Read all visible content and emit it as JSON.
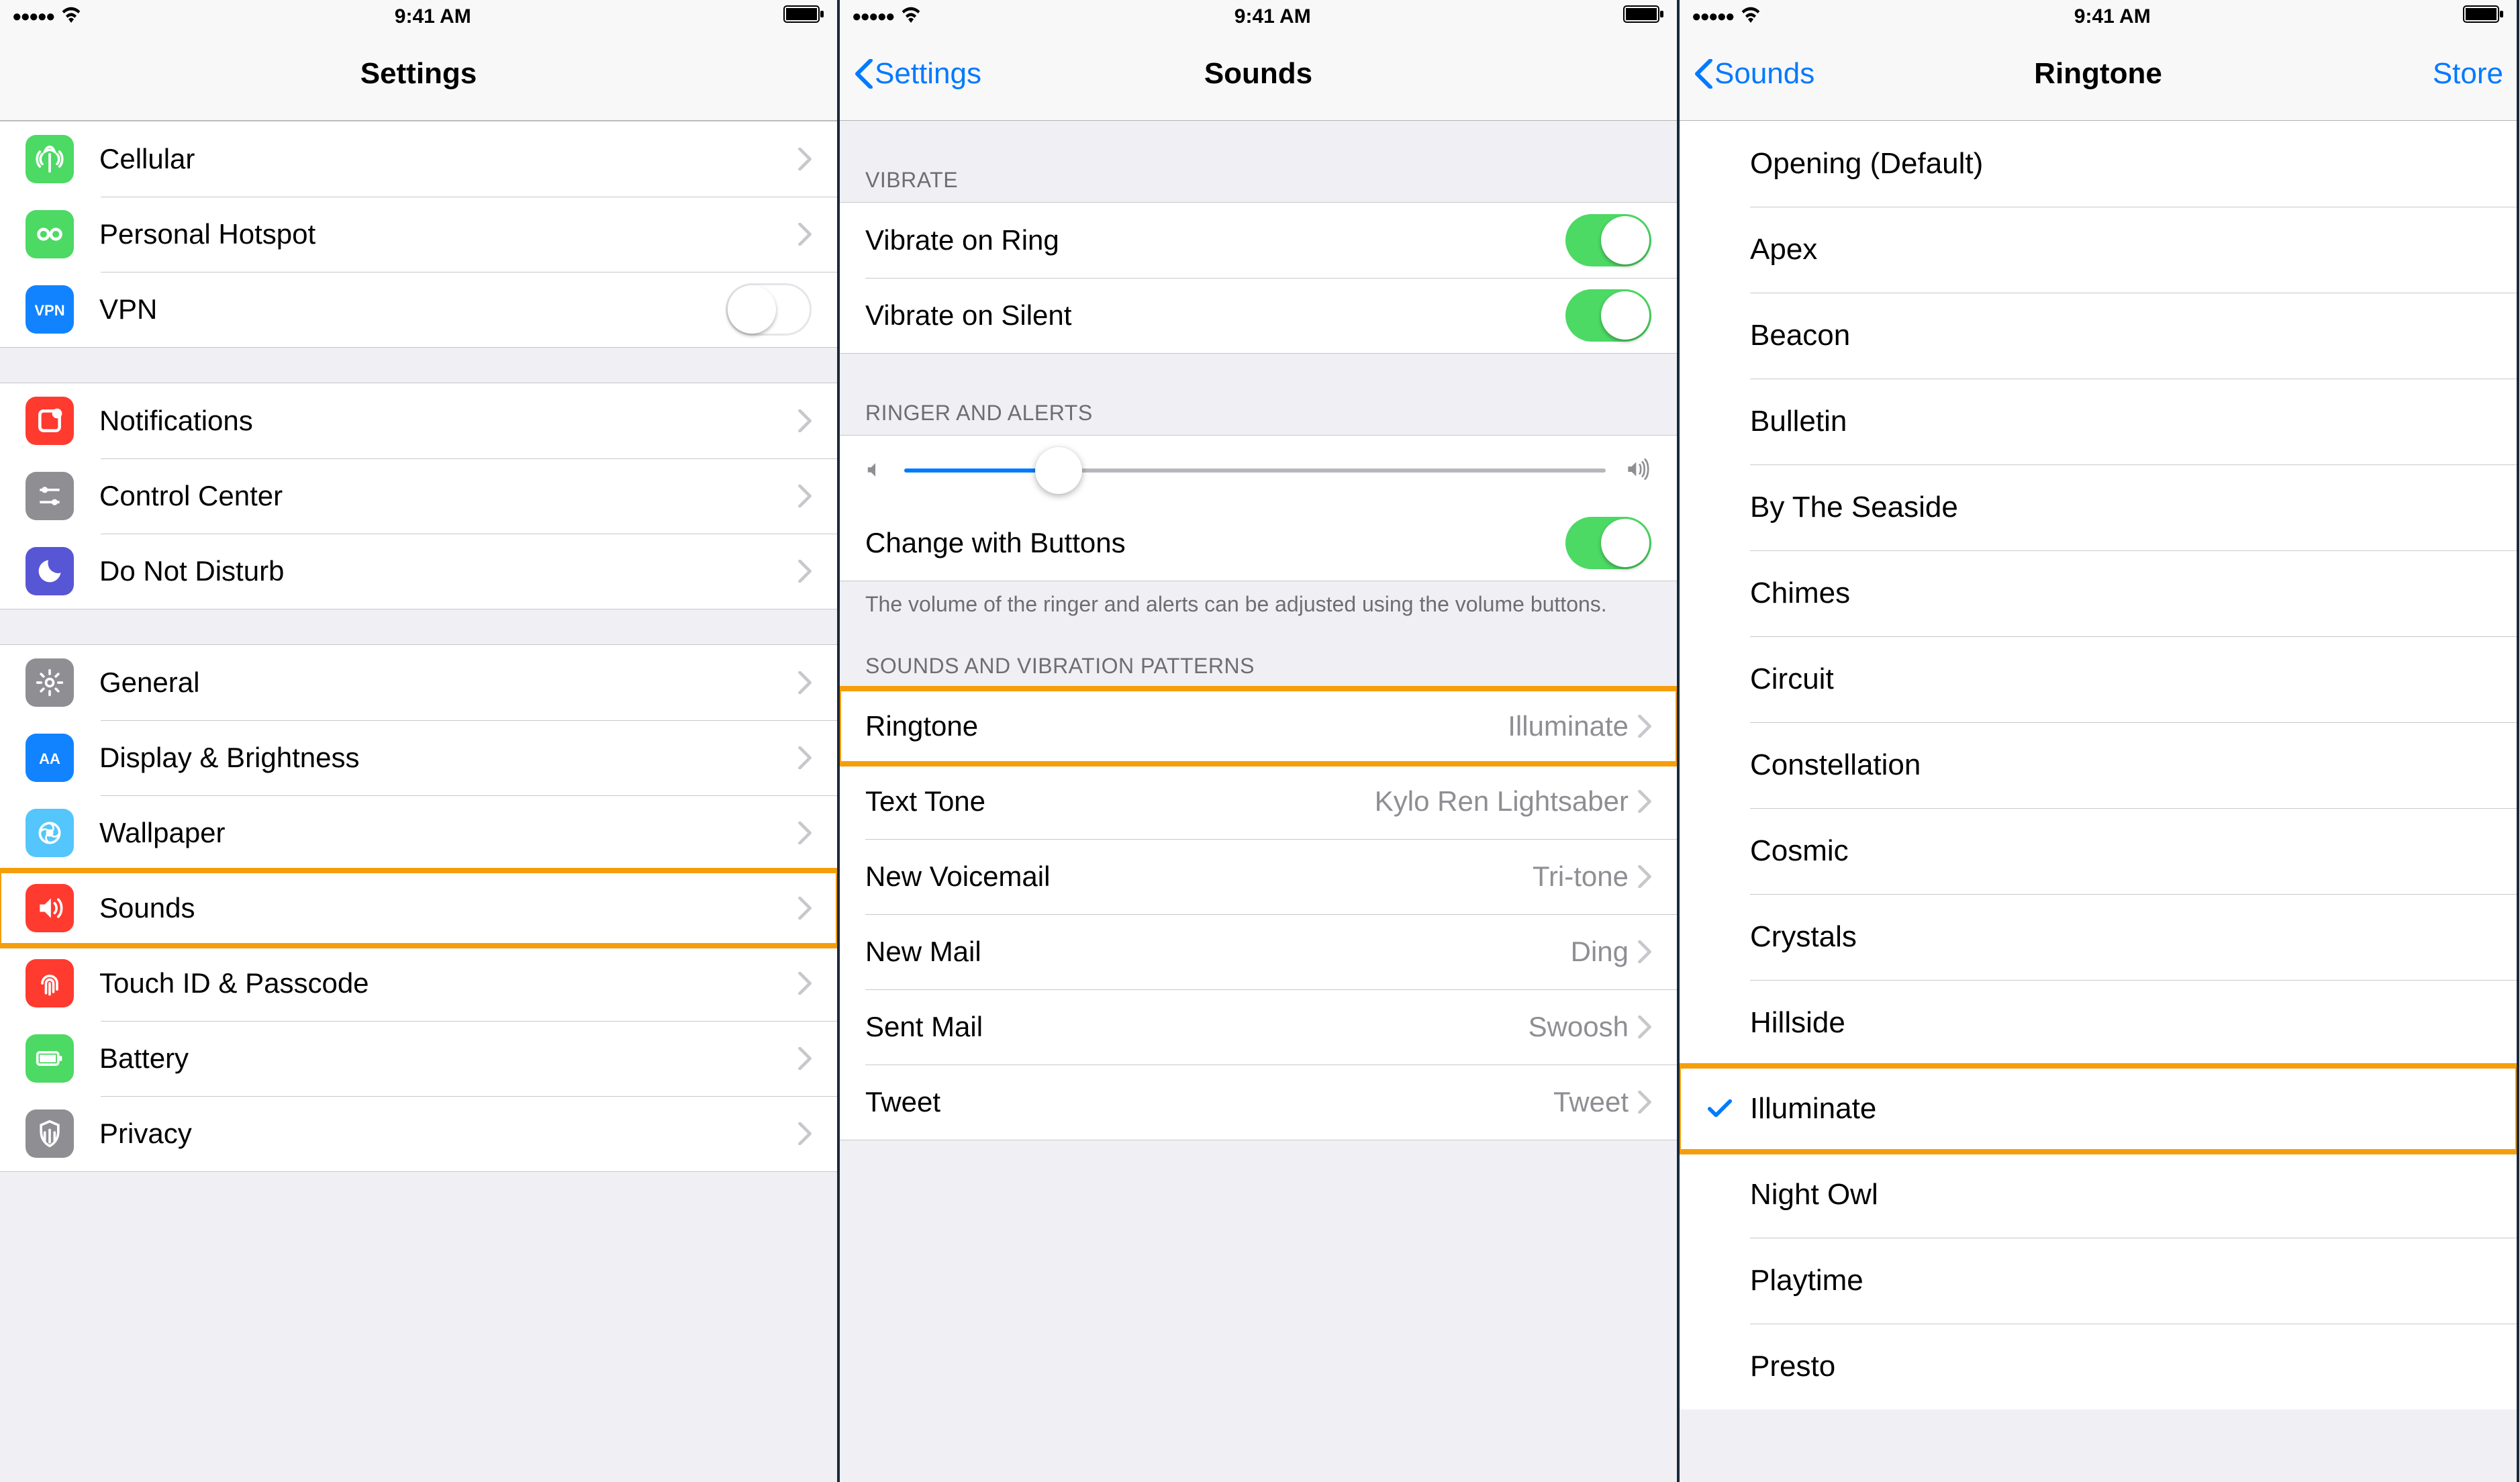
{
  "status": {
    "time": "9:41 AM"
  },
  "screen1": {
    "title": "Settings",
    "group1": [
      {
        "icon": "cellular",
        "color": "#4cd964",
        "label": "Cellular"
      },
      {
        "icon": "hotspot",
        "color": "#4cd964",
        "label": "Personal Hotspot"
      },
      {
        "icon": "vpn",
        "color": "#1283ff",
        "label": "VPN",
        "toggle": false
      }
    ],
    "group2": [
      {
        "icon": "notifications",
        "color": "#ff3b30",
        "label": "Notifications"
      },
      {
        "icon": "controlcenter",
        "color": "#8e8e93",
        "label": "Control Center"
      },
      {
        "icon": "dnd",
        "color": "#5756d5",
        "label": "Do Not Disturb"
      }
    ],
    "group3": [
      {
        "icon": "general",
        "color": "#8e8e93",
        "label": "General"
      },
      {
        "icon": "display",
        "color": "#1283ff",
        "label": "Display & Brightness"
      },
      {
        "icon": "wallpaper",
        "color": "#54c6fb",
        "label": "Wallpaper"
      },
      {
        "icon": "sounds",
        "color": "#ff3b30",
        "label": "Sounds",
        "highlight": true
      },
      {
        "icon": "touchid",
        "color": "#ff3b30",
        "label": "Touch ID & Passcode"
      },
      {
        "icon": "battery",
        "color": "#4cd964",
        "label": "Battery"
      },
      {
        "icon": "privacy",
        "color": "#8e8e93",
        "label": "Privacy"
      }
    ]
  },
  "screen2": {
    "back": "Settings",
    "title": "Sounds",
    "vibrate_header": "VIBRATE",
    "vibrate_ring": "Vibrate on Ring",
    "vibrate_silent": "Vibrate on Silent",
    "ringer_header": "RINGER AND ALERTS",
    "change_buttons": "Change with Buttons",
    "ringer_footer": "The volume of the ringer and alerts can be adjusted using the volume buttons.",
    "sounds_header": "SOUNDS AND VIBRATION PATTERNS",
    "slider_value": 22,
    "patterns": [
      {
        "label": "Ringtone",
        "value": "Illuminate",
        "highlight": true
      },
      {
        "label": "Text Tone",
        "value": "Kylo Ren Lightsaber"
      },
      {
        "label": "New Voicemail",
        "value": "Tri-tone"
      },
      {
        "label": "New Mail",
        "value": "Ding"
      },
      {
        "label": "Sent Mail",
        "value": "Swoosh"
      },
      {
        "label": "Tweet",
        "value": "Tweet"
      }
    ]
  },
  "screen3": {
    "back": "Sounds",
    "title": "Ringtone",
    "right": "Store",
    "tones": [
      {
        "label": "Opening (Default)"
      },
      {
        "label": "Apex"
      },
      {
        "label": "Beacon"
      },
      {
        "label": "Bulletin"
      },
      {
        "label": "By The Seaside"
      },
      {
        "label": "Chimes"
      },
      {
        "label": "Circuit"
      },
      {
        "label": "Constellation"
      },
      {
        "label": "Cosmic"
      },
      {
        "label": "Crystals"
      },
      {
        "label": "Hillside"
      },
      {
        "label": "Illuminate",
        "checked": true,
        "highlight": true
      },
      {
        "label": "Night Owl"
      },
      {
        "label": "Playtime"
      },
      {
        "label": "Presto"
      }
    ]
  }
}
